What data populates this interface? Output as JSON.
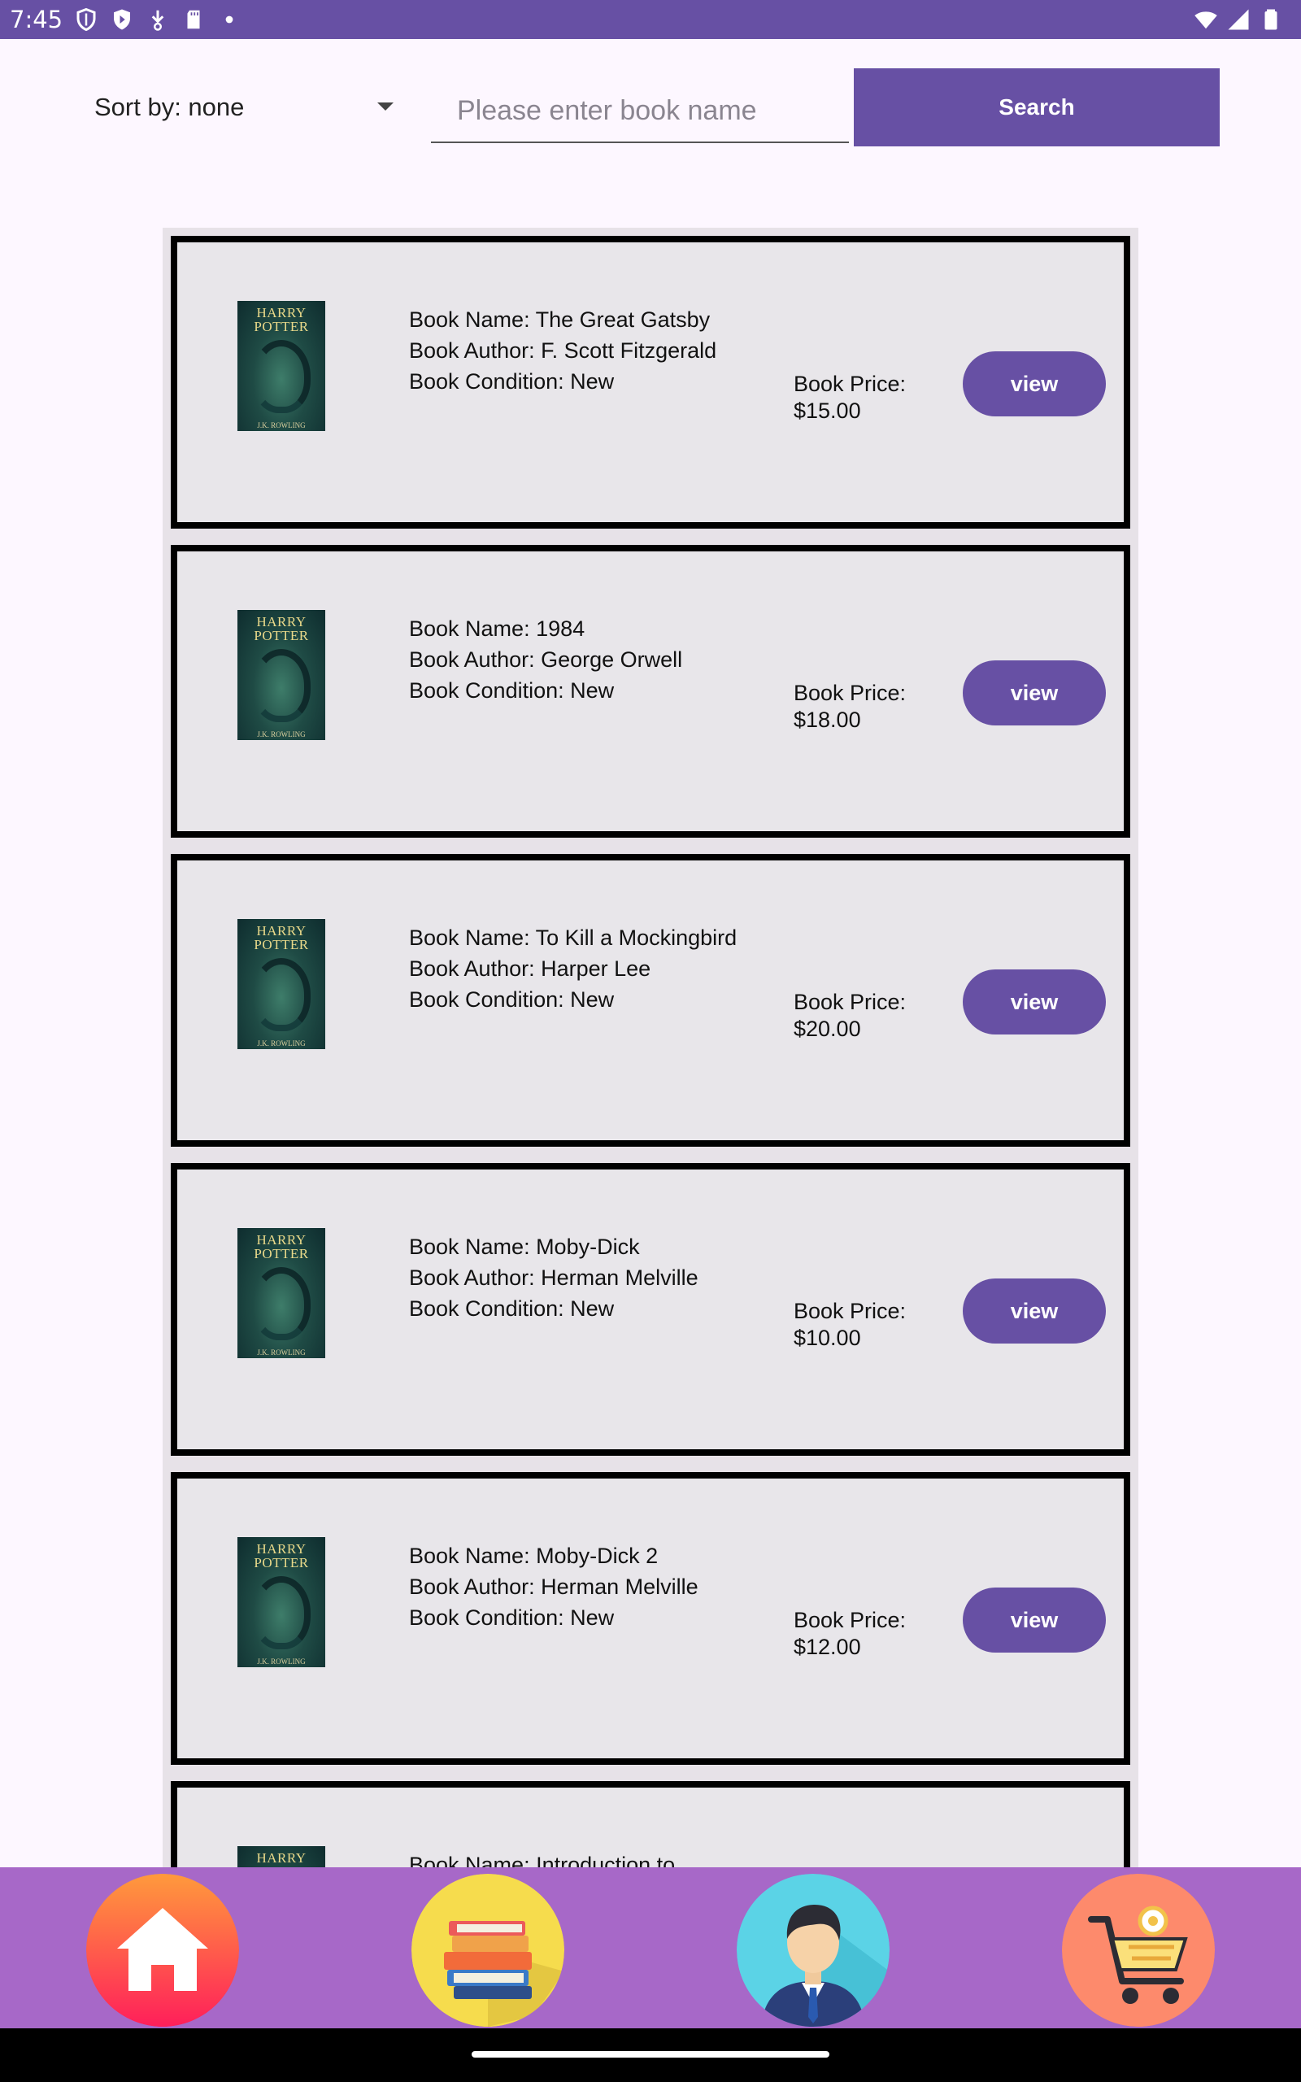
{
  "status_bar": {
    "time": "7:45"
  },
  "toolbar": {
    "sort_label": "Sort by: none",
    "search_placeholder": "Please enter book name",
    "search_value": "",
    "search_button_label": "Search"
  },
  "books": [
    {
      "name": "Book Name: The Great Gatsby",
      "author": "Book Author: F. Scott Fitzgerald",
      "condition": "Book Condition: New",
      "price_label": "Book Price:",
      "price": "$15.00",
      "view_label": "view",
      "cover": {
        "title_line1": "HARRY",
        "title_line2": "POTTER",
        "author": "J.K. ROWLING"
      }
    },
    {
      "name": "Book Name: 1984",
      "author": "Book Author: George Orwell",
      "condition": "Book Condition: New",
      "price_label": "Book Price:",
      "price": "$18.00",
      "view_label": "view",
      "cover": {
        "title_line1": "HARRY",
        "title_line2": "POTTER",
        "author": "J.K. ROWLING"
      }
    },
    {
      "name": "Book Name: To Kill a Mockingbird",
      "author": "Book Author: Harper Lee",
      "condition": "Book Condition: New",
      "price_label": "Book Price:",
      "price": "$20.00",
      "view_label": "view",
      "cover": {
        "title_line1": "HARRY",
        "title_line2": "POTTER",
        "author": "J.K. ROWLING"
      }
    },
    {
      "name": "Book Name: Moby-Dick",
      "author": "Book Author: Herman Melville",
      "condition": "Book Condition: New",
      "price_label": "Book Price:",
      "price": "$10.00",
      "view_label": "view",
      "cover": {
        "title_line1": "HARRY",
        "title_line2": "POTTER",
        "author": "J.K. ROWLING"
      }
    },
    {
      "name": "Book Name: Moby-Dick 2",
      "author": "Book Author: Herman Melville",
      "condition": "Book Condition: New",
      "price_label": "Book Price:",
      "price": "$12.00",
      "view_label": "view",
      "cover": {
        "title_line1": "HARRY",
        "title_line2": "POTTER",
        "author": "J.K. ROWLING"
      }
    },
    {
      "name": "Book Name: Introduction to",
      "author": "",
      "condition": "",
      "price_label": "",
      "price": "",
      "view_label": "",
      "cover": {
        "title_line1": "HARRY",
        "title_line2": "",
        "author": ""
      }
    }
  ],
  "bottom_nav": {
    "items": [
      {
        "icon": "home-icon"
      },
      {
        "icon": "books-icon"
      },
      {
        "icon": "profile-icon"
      },
      {
        "icon": "cart-icon"
      }
    ]
  },
  "colors": {
    "primary": "#6750a4",
    "nav_background": "#a768c8",
    "page_background": "#fdf7ff",
    "card_background": "#e8e6ea"
  }
}
